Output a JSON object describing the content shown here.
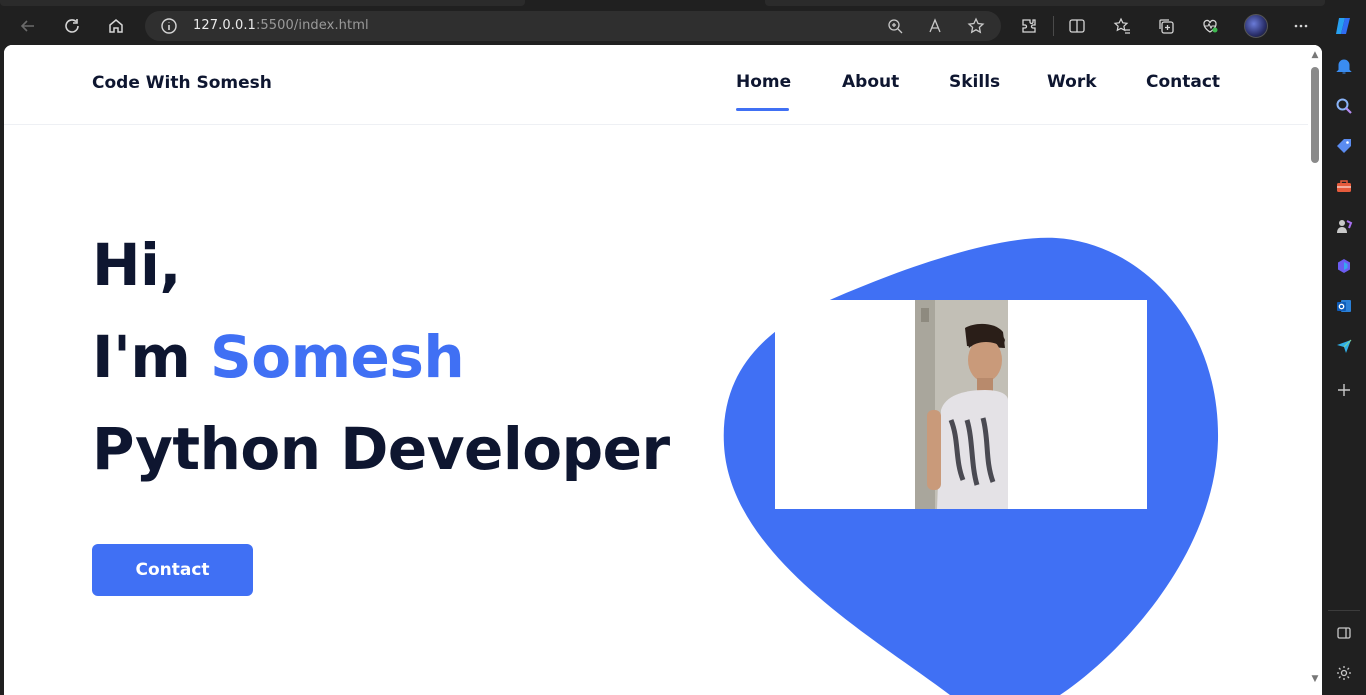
{
  "browser": {
    "url_host": "127.0.0.1",
    "url_rest": ":5500/index.html",
    "icons": [
      "back-icon",
      "refresh-icon",
      "home-icon",
      "info-icon",
      "zoom-icon",
      "read-aloud-icon",
      "favorite-star-icon",
      "extensions-icon",
      "split-screen-icon",
      "favorites-icon",
      "collections-icon",
      "browser-essentials-icon",
      "profile-avatar",
      "more-icon",
      "copilot-icon"
    ]
  },
  "sidebar": {
    "icons": [
      "notifications-icon",
      "search-icon",
      "shopping-icon",
      "tools-icon",
      "games-icon",
      "microsoft-365-icon",
      "outlook-icon",
      "send-icon",
      "add-icon",
      "hide-sidebar-icon",
      "settings-icon"
    ]
  },
  "site": {
    "logo": "Code With Somesh",
    "nav": [
      {
        "label": "Home",
        "active": true
      },
      {
        "label": "About",
        "active": false
      },
      {
        "label": "Skills",
        "active": false
      },
      {
        "label": "Work",
        "active": false
      },
      {
        "label": "Contact",
        "active": false
      }
    ],
    "hero": {
      "greeting": "Hi,",
      "intro_prefix": "I'm ",
      "name": "Somesh",
      "role": "Python Developer",
      "cta": "Contact"
    },
    "colors": {
      "accent": "#4070f4",
      "text": "#0e1630"
    }
  }
}
